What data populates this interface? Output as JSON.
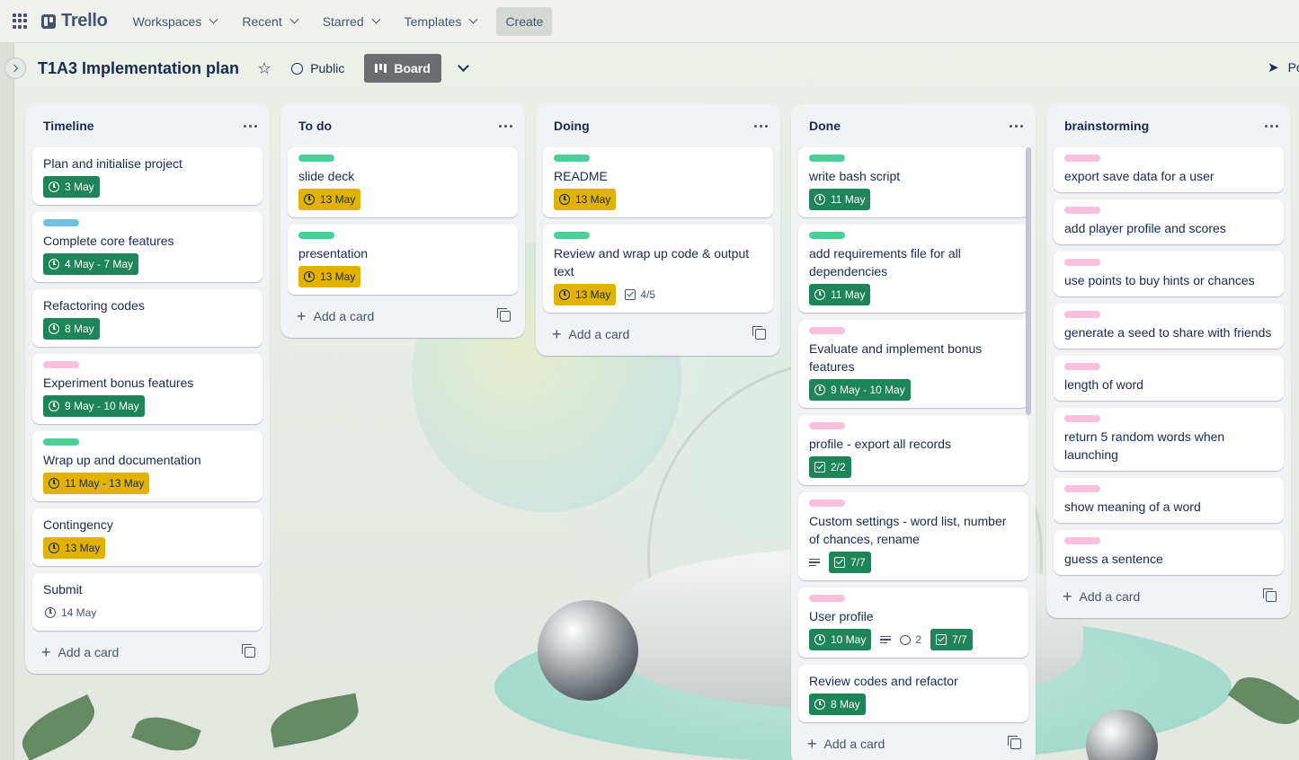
{
  "nav": {
    "logo": "Trello",
    "workspaces": "Workspaces",
    "recent": "Recent",
    "starred": "Starred",
    "templates": "Templates",
    "create": "Create"
  },
  "board": {
    "title": "T1A3 Implementation plan",
    "visibility": "Public",
    "view": "Board",
    "right_partial": "Pc"
  },
  "colors": {
    "green_badge": "#1f845a",
    "yellow_badge": "#e2b203",
    "label_green": "#4bce97",
    "label_teal": "#6cc3e0",
    "label_pink": "#f9c0dc"
  },
  "add_card_label": "Add a card",
  "lists": [
    {
      "title": "Timeline",
      "cards": [
        {
          "title": "Plan and initialise project",
          "date": "3 May",
          "date_style": "green"
        },
        {
          "label": "teal",
          "title": "Complete core features",
          "date": "4 May - 7 May",
          "date_style": "green"
        },
        {
          "title": "Refactoring codes",
          "date": "8 May",
          "date_style": "green"
        },
        {
          "label": "pink",
          "title": "Experiment bonus features",
          "date": "9 May - 10 May",
          "date_style": "green"
        },
        {
          "label": "green",
          "title": "Wrap up and documentation",
          "date": "11 May - 13 May",
          "date_style": "yellow"
        },
        {
          "title": "Contingency",
          "date": "13 May",
          "date_style": "yellow"
        },
        {
          "title": "Submit",
          "date": "14 May",
          "date_style": "plain"
        }
      ]
    },
    {
      "title": "To do",
      "cards": [
        {
          "label": "green",
          "title": "slide deck",
          "date": "13 May",
          "date_style": "yellow"
        },
        {
          "label": "green",
          "title": "presentation",
          "date": "13 May",
          "date_style": "yellow"
        }
      ]
    },
    {
      "title": "Doing",
      "cards": [
        {
          "label": "green",
          "title": "README",
          "date": "13 May",
          "date_style": "yellow"
        },
        {
          "label": "green",
          "title": "Review and wrap up code & output text",
          "date": "13 May",
          "date_style": "yellow",
          "checklist": "4/5",
          "checklist_style": "plain"
        }
      ]
    },
    {
      "title": "Done",
      "cards": [
        {
          "label": "green",
          "title": "write bash script",
          "date": "11 May",
          "date_style": "green"
        },
        {
          "label": "green",
          "title": "add requirements file for all dependencies",
          "date": "11 May",
          "date_style": "green"
        },
        {
          "label": "pink",
          "title": "Evaluate and implement bonus features",
          "date": "9 May - 10 May",
          "date_style": "green"
        },
        {
          "label": "pink",
          "title": "profile - export all records",
          "checklist": "2/2",
          "checklist_style": "green"
        },
        {
          "label": "pink",
          "title": "Custom settings - word list, number of chances, rename",
          "description": true,
          "checklist": "7/7",
          "checklist_style": "green"
        },
        {
          "label": "pink",
          "title": "User profile",
          "date": "10 May",
          "date_style": "green",
          "description": true,
          "comments": "2",
          "checklist": "7/7",
          "checklist_style": "green"
        },
        {
          "title": "Review codes and refactor",
          "date": "8 May",
          "date_style": "green"
        }
      ]
    },
    {
      "title": "brainstorming",
      "cards": [
        {
          "label": "pink",
          "title": "export save data for a user"
        },
        {
          "label": "pink",
          "title": "add player profile and scores"
        },
        {
          "label": "pink",
          "title": "use points to buy hints or chances"
        },
        {
          "label": "pink",
          "title": "generate a seed to share with friends"
        },
        {
          "label": "pink",
          "title": "length of word"
        },
        {
          "label": "pink",
          "title": "return 5 random words when launching"
        },
        {
          "label": "pink",
          "title": "show meaning of a word"
        },
        {
          "label": "pink",
          "title": "guess a sentence"
        }
      ]
    }
  ]
}
